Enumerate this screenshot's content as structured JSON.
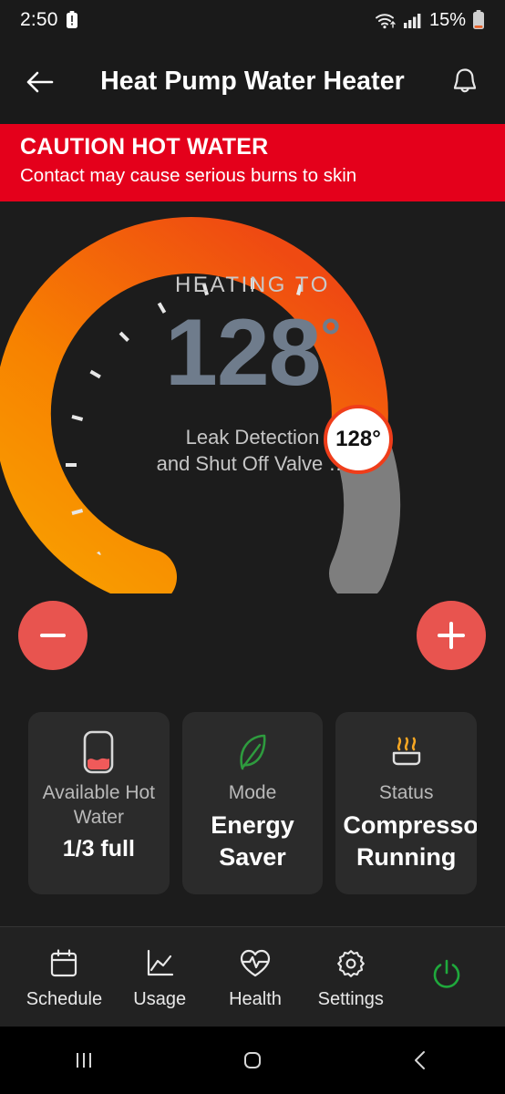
{
  "statusbar": {
    "time": "2:50",
    "battery_percent": "15%",
    "icons": [
      "battery-alert-icon",
      "wifi-icon",
      "cellular-signal-icon",
      "battery-icon"
    ]
  },
  "appbar": {
    "title": "Heat Pump Water Heater",
    "back_icon": "back-arrow-icon",
    "notification_icon": "bell-icon"
  },
  "caution": {
    "title": "CAUTION HOT WATER",
    "subtitle": "Contact may cause serious burns to skin",
    "background": "#E4001B"
  },
  "dial": {
    "state_label": "HEATING TO",
    "temperature": "128",
    "degree": "°",
    "handle_value": "128°",
    "sub_line_1": "Leak Detection",
    "sub_line_2": "and Shut Off Valve …",
    "active_color_start": "#F9A000",
    "active_color_end": "#EF4A12",
    "track_color": "#7E7E7E",
    "handle_border": "#EF3D1A"
  },
  "controls": {
    "decrease_label": "−",
    "increase_label": "+",
    "button_color": "#E8544F"
  },
  "cards": [
    {
      "icon": "water-tank-icon",
      "label": "Available Hot Water",
      "value": "1/3 full",
      "icon_color": "#F05A5A"
    },
    {
      "icon": "leaf-icon",
      "label": "Mode",
      "value": "Energy Saver",
      "icon_color": "#2E9B3E"
    },
    {
      "icon": "heat-waves-icon",
      "label": "Status",
      "value": "Compressor Running",
      "icon_color": "#F5A623"
    }
  ],
  "bottom_nav": [
    {
      "icon": "calendar-icon",
      "label": "Schedule"
    },
    {
      "icon": "line-chart-icon",
      "label": "Usage"
    },
    {
      "icon": "heart-pulse-icon",
      "label": "Health"
    },
    {
      "icon": "gear-icon",
      "label": "Settings"
    },
    {
      "icon": "power-icon",
      "label": ""
    }
  ],
  "system_nav": {
    "recents": "recents-icon",
    "home": "home-icon",
    "back": "back-icon"
  }
}
